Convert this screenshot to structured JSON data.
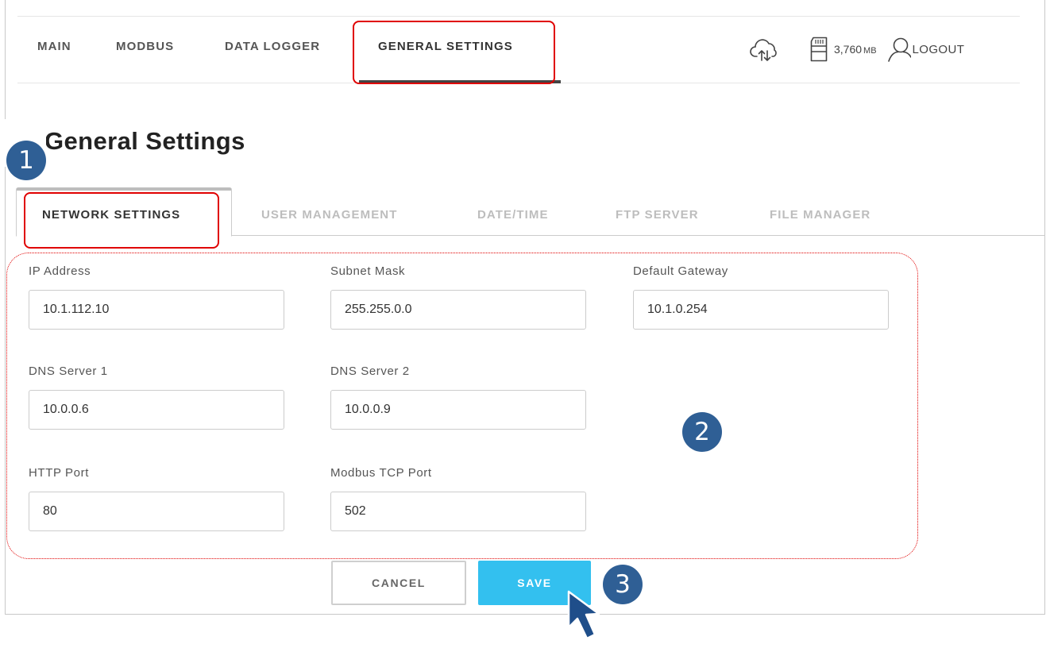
{
  "nav": {
    "items": [
      {
        "label": "MAIN"
      },
      {
        "label": "MODBUS"
      },
      {
        "label": "DATA LOGGER"
      },
      {
        "label": "GENERAL SETTINGS",
        "active": true
      }
    ],
    "storage_value": "3,760",
    "storage_unit": "MB",
    "logout_label": "LOGOUT"
  },
  "page": {
    "title": "General Settings"
  },
  "tabs": [
    {
      "label": "NETWORK SETTINGS",
      "active": true
    },
    {
      "label": "USER MANAGEMENT"
    },
    {
      "label": "DATE/TIME"
    },
    {
      "label": "FTP SERVER"
    },
    {
      "label": "FILE MANAGER"
    }
  ],
  "form": {
    "ip_address": {
      "label": "IP Address",
      "value": "10.1.112.10"
    },
    "subnet_mask": {
      "label": "Subnet Mask",
      "value": "255.255.0.0"
    },
    "default_gateway": {
      "label": "Default Gateway",
      "value": "10.1.0.254"
    },
    "dns_server_1": {
      "label": "DNS Server 1",
      "value": "10.0.0.6"
    },
    "dns_server_2": {
      "label": "DNS Server 2",
      "value": "10.0.0.9"
    },
    "http_port": {
      "label": "HTTP Port",
      "value": "80"
    },
    "modbus_tcp_port": {
      "label": "Modbus TCP Port",
      "value": "502"
    }
  },
  "buttons": {
    "cancel_label": "CANCEL",
    "save_label": "SAVE"
  },
  "callouts": {
    "step1": "1",
    "step2": "2",
    "step3": "3"
  },
  "colors": {
    "highlight": "#e00000",
    "callout": "#2f5f95",
    "save_button": "#33c0ef",
    "cursor": "#1f4e8a"
  },
  "icons": {
    "cloud": "cloud-upload-download-icon",
    "storage": "sd-card-icon",
    "user": "user-icon",
    "pointer": "mouse-pointer-icon"
  }
}
